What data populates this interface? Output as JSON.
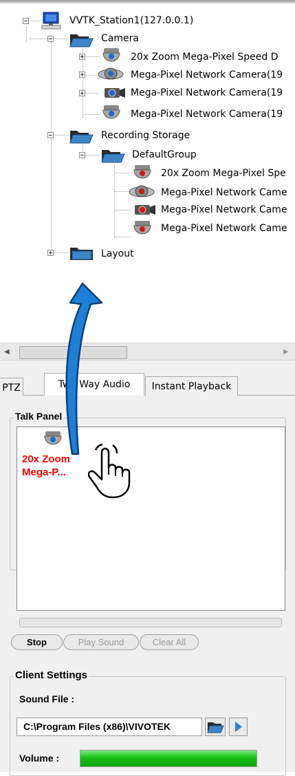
{
  "tree": {
    "station": "VVTK_Station1(127.0.0.1)",
    "camera_folder": "Camera",
    "cameras": [
      "20x Zoom Mega-Pixel Speed D",
      "Mega-Pixel Network Camera(19",
      "Mega-Pixel Network Camera(19",
      "Mega-Pixel Network Camera(19"
    ],
    "storage_folder": "Recording Storage",
    "default_group": "DefaultGroup",
    "group_cameras": [
      "20x Zoom Mega-Pixel Spe",
      "Mega-Pixel Network Came",
      "Mega-Pixel Network Came",
      "Mega-Pixel Network Came"
    ],
    "layout": "Layout"
  },
  "tabs": [
    "PTZ",
    "Two Way Audio",
    "Instant Playback"
  ],
  "talk_panel": {
    "title": "Talk Panel",
    "device_label_1": "20x Zoom",
    "device_label_2": "Mega-P...",
    "device_label_color": "#ff0000"
  },
  "buttons": {
    "stop": "Stop",
    "play_sound": "Play Sound",
    "clear_all": "Clear All"
  },
  "client_settings": {
    "title": "Client Settings",
    "sound_file_label": "Sound File :",
    "sound_file_value": "C:\\Program Files (x86)\\VIVOTEK",
    "volume_label": "Volume :",
    "volume_level": 1.0,
    "volume_color": "#22cc22"
  },
  "annotation": {
    "arrow_color": "#1e7fd6",
    "icons": [
      "curved-arrow-icon",
      "hand-pointer-icon"
    ]
  }
}
